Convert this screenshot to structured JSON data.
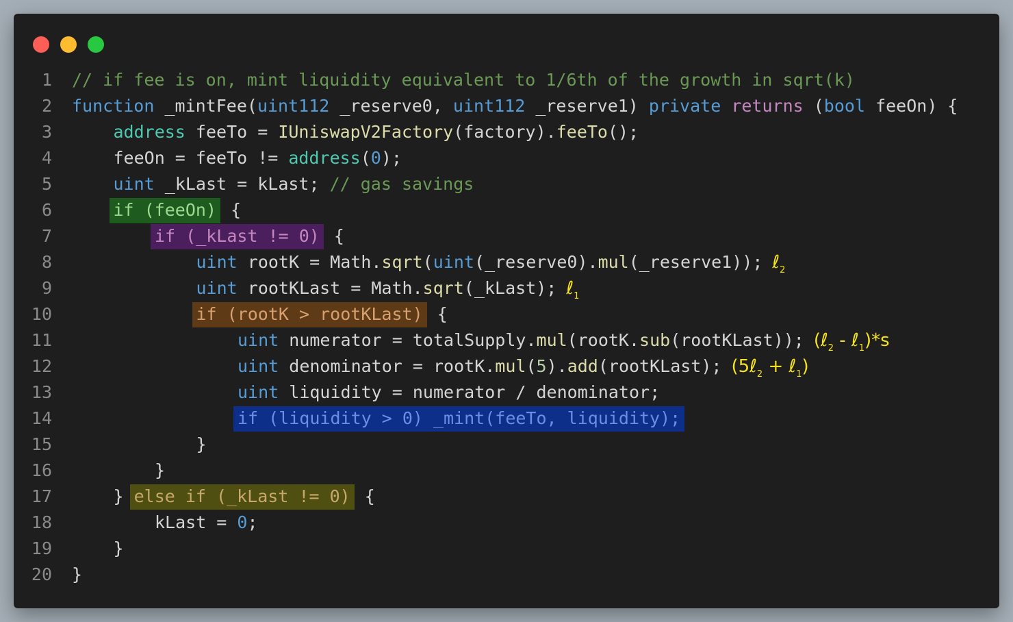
{
  "window": {
    "controls": [
      "close",
      "minimize",
      "maximize"
    ]
  },
  "lines": [
    {
      "n": "1",
      "parts": [
        {
          "t": "// if fee is on, mint liquidity equivalent to 1/6th of the growth in sqrt(k)",
          "c": "cm"
        }
      ]
    },
    {
      "n": "2",
      "parts": [
        {
          "t": "function",
          "c": "kw"
        },
        {
          "t": " _mintFee("
        },
        {
          "t": "uint112",
          "c": "kw"
        },
        {
          "t": " _reserve0, "
        },
        {
          "t": "uint112",
          "c": "kw"
        },
        {
          "t": " _reserve1) "
        },
        {
          "t": "private",
          "c": "kw"
        },
        {
          "t": " "
        },
        {
          "t": "returns",
          "c": "ctl"
        },
        {
          "t": " ("
        },
        {
          "t": "bool",
          "c": "kw"
        },
        {
          "t": " feeOn) {"
        }
      ]
    },
    {
      "n": "3",
      "indent": 1,
      "parts": [
        {
          "t": "address",
          "c": "ty"
        },
        {
          "t": " feeTo = "
        },
        {
          "t": "IUniswapV2Factory",
          "c": "fn"
        },
        {
          "t": "(factory)."
        },
        {
          "t": "feeTo",
          "c": "fn"
        },
        {
          "t": "();"
        }
      ]
    },
    {
      "n": "4",
      "indent": 1,
      "parts": [
        {
          "t": "feeOn = feeTo != "
        },
        {
          "t": "address",
          "c": "ty"
        },
        {
          "t": "("
        },
        {
          "t": "0",
          "c": "zero"
        },
        {
          "t": ");"
        }
      ]
    },
    {
      "n": "5",
      "indent": 1,
      "parts": [
        {
          "t": "uint",
          "c": "kw"
        },
        {
          "t": " _kLast = kLast; "
        },
        {
          "t": "// gas savings",
          "c": "cm"
        }
      ]
    },
    {
      "n": "6",
      "indent": 1,
      "parts": [
        {
          "t": "if (feeOn)",
          "hl": "green"
        },
        {
          "t": " {"
        }
      ]
    },
    {
      "n": "7",
      "indent": 2,
      "parts": [
        {
          "t": "if (_kLast != 0)",
          "hl": "purple"
        },
        {
          "t": " {"
        }
      ]
    },
    {
      "n": "8",
      "indent": 3,
      "parts": [
        {
          "t": "uint",
          "c": "kw"
        },
        {
          "t": " rootK = Math."
        },
        {
          "t": "sqrt",
          "c": "fn"
        },
        {
          "t": "("
        },
        {
          "t": "uint",
          "c": "kw"
        },
        {
          "t": "(_reserve0)."
        },
        {
          "t": "mul",
          "c": "fn"
        },
        {
          "t": "(_reserve1));"
        }
      ],
      "ann": [
        {
          "t": "ℓ"
        },
        {
          "sub": "2"
        }
      ]
    },
    {
      "n": "9",
      "indent": 3,
      "parts": [
        {
          "t": "uint",
          "c": "kw"
        },
        {
          "t": " rootKLast = Math."
        },
        {
          "t": "sqrt",
          "c": "fn"
        },
        {
          "t": "(_kLast);"
        }
      ],
      "ann": [
        {
          "t": "ℓ"
        },
        {
          "sub": "1"
        }
      ]
    },
    {
      "n": "10",
      "indent": 3,
      "parts": [
        {
          "t": "if (rootK > rootKLast)",
          "hl": "brown"
        },
        {
          "t": " {"
        }
      ]
    },
    {
      "n": "11",
      "indent": 4,
      "parts": [
        {
          "t": "uint",
          "c": "kw"
        },
        {
          "t": " numerator = totalSupply."
        },
        {
          "t": "mul",
          "c": "fn"
        },
        {
          "t": "(rootK."
        },
        {
          "t": "sub",
          "c": "fn"
        },
        {
          "t": "(rootKLast));"
        }
      ],
      "ann": [
        {
          "t": "(ℓ"
        },
        {
          "sub": "2"
        },
        {
          "t": " - ℓ"
        },
        {
          "sub": "1"
        },
        {
          "t": ")*s"
        }
      ]
    },
    {
      "n": "12",
      "indent": 4,
      "parts": [
        {
          "t": "uint",
          "c": "kw"
        },
        {
          "t": " denominator = rootK."
        },
        {
          "t": "mul",
          "c": "fn"
        },
        {
          "t": "("
        },
        {
          "t": "5",
          "c": "num"
        },
        {
          "t": ")."
        },
        {
          "t": "add",
          "c": "fn"
        },
        {
          "t": "(rootKLast);"
        }
      ],
      "ann": [
        {
          "t": "(5ℓ"
        },
        {
          "sub": "2"
        },
        {
          "t": " + ℓ"
        },
        {
          "sub": "1"
        },
        {
          "t": ")"
        }
      ]
    },
    {
      "n": "13",
      "indent": 4,
      "parts": [
        {
          "t": "uint",
          "c": "kw"
        },
        {
          "t": " liquidity = numerator / denominator;"
        }
      ]
    },
    {
      "n": "14",
      "indent": 4,
      "parts": [
        {
          "t": "if (liquidity > 0) _mint(feeTo, liquidity);",
          "hl": "blue"
        }
      ]
    },
    {
      "n": "15",
      "indent": 3,
      "parts": [
        {
          "t": "}"
        }
      ]
    },
    {
      "n": "16",
      "indent": 2,
      "parts": [
        {
          "t": "}"
        }
      ]
    },
    {
      "n": "17",
      "indent": 1,
      "parts": [
        {
          "t": "} "
        },
        {
          "t": "else if (_kLast != 0)",
          "hl": "olive"
        },
        {
          "t": " {"
        }
      ]
    },
    {
      "n": "18",
      "indent": 2,
      "parts": [
        {
          "t": "kLast = "
        },
        {
          "t": "0",
          "c": "zero"
        },
        {
          "t": ";"
        }
      ]
    },
    {
      "n": "19",
      "indent": 1,
      "parts": [
        {
          "t": "}"
        }
      ]
    },
    {
      "n": "20",
      "parts": [
        {
          "t": "}"
        }
      ]
    }
  ]
}
